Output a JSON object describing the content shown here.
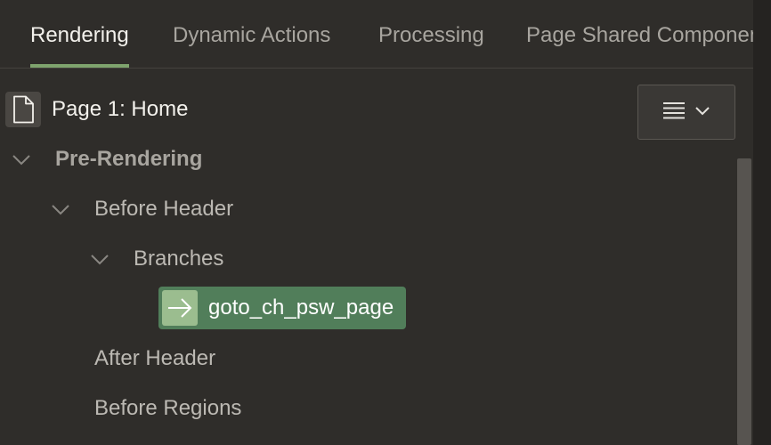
{
  "tabs": [
    {
      "label": "Rendering",
      "active": true
    },
    {
      "label": "Dynamic Actions",
      "active": false
    },
    {
      "label": "Processing",
      "active": false
    },
    {
      "label": "Page Shared Componen",
      "active": false
    }
  ],
  "page": {
    "title": "Page 1: Home",
    "icon": "page-icon"
  },
  "menu_button": {
    "icon": "hamburger-menu-icon",
    "dropdown_icon": "chevron-down-icon"
  },
  "tree": {
    "pre_rendering": "Pre-Rendering",
    "before_header": "Before Header",
    "branches": "Branches",
    "selected_item": "goto_ch_psw_page",
    "after_header": "After Header",
    "before_regions": "Before Regions"
  },
  "colors": {
    "background": "#2f2d2a",
    "accent": "#7ea36d",
    "selected": "#517e5a"
  }
}
